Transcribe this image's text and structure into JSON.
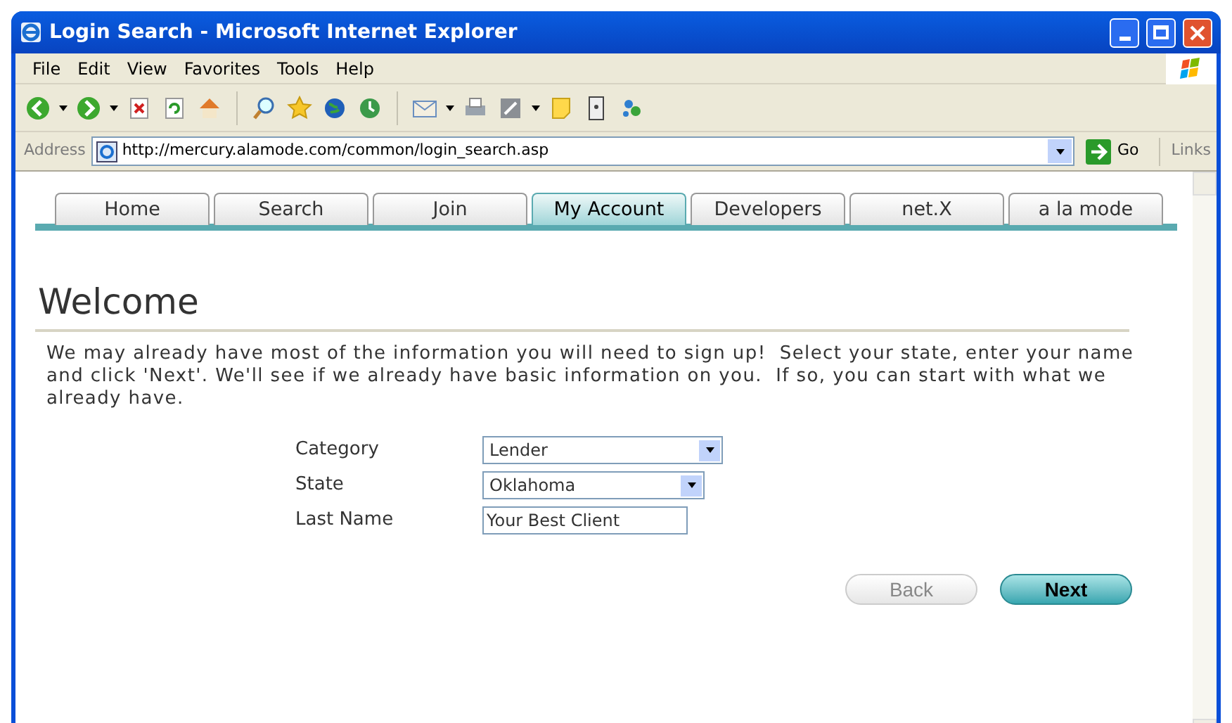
{
  "window": {
    "title": "Login Search - Microsoft Internet Explorer"
  },
  "menu": [
    "File",
    "Edit",
    "View",
    "Favorites",
    "Tools",
    "Help"
  ],
  "address_bar": {
    "label": "Address",
    "url": "http://mercury.alamode.com/common/login_search.asp",
    "go": "Go",
    "links": "Links"
  },
  "tabs": [
    {
      "label": "Home",
      "selected": false
    },
    {
      "label": "Search",
      "selected": false
    },
    {
      "label": "Join",
      "selected": false
    },
    {
      "label": "My Account",
      "selected": true
    },
    {
      "label": "Developers",
      "selected": false
    },
    {
      "label": "net.X",
      "selected": false
    },
    {
      "label": "a la mode",
      "selected": false
    }
  ],
  "heading": "Welcome",
  "intro": "We may already have most of the information you will need to sign up!  Select your state, enter your name and click 'Next'. We'll see if we already have basic information on you.  If so, you can start with what we already have.",
  "form": [
    {
      "label": "Category",
      "kind": "select",
      "value": "Lender"
    },
    {
      "label": "State",
      "kind": "select",
      "value": "Oklahoma"
    },
    {
      "label": "Last Name",
      "kind": "text",
      "value": "Your Best Client"
    }
  ],
  "buttons": [
    {
      "label": "Back",
      "disabled": true
    },
    {
      "label": "Next",
      "disabled": false
    }
  ]
}
